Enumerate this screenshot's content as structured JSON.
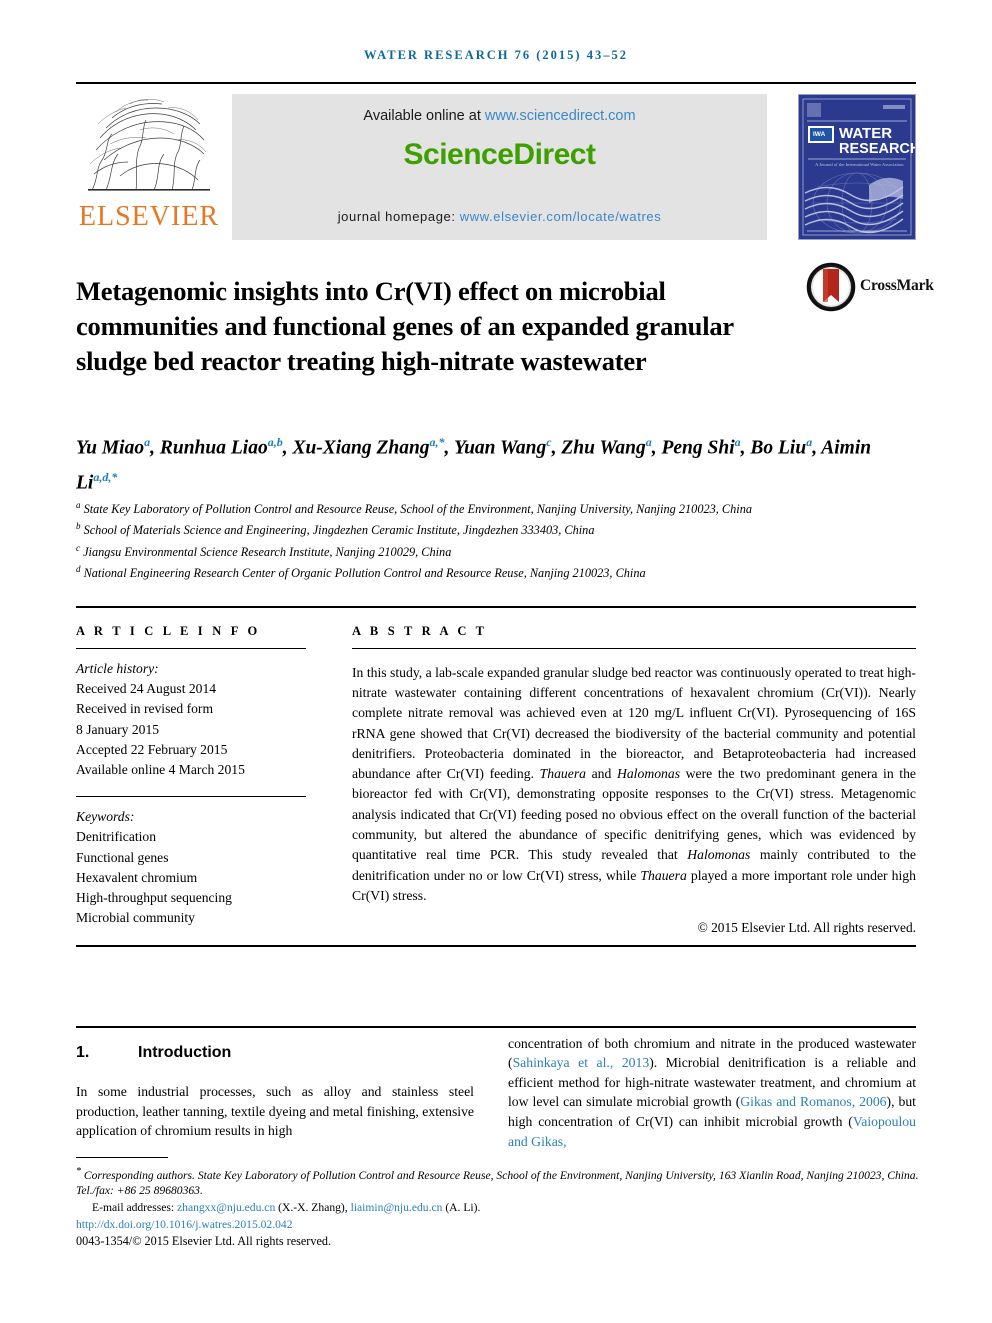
{
  "running_head": "WATER RESEARCH 76 (2015) 43–52",
  "masthead": {
    "available_text": "Available online at ",
    "available_url": "www.sciencedirect.com",
    "sciencedirect_logo": "ScienceDirect",
    "homepage_text": "journal homepage: ",
    "homepage_url": "www.elsevier.com/locate/watres",
    "elsevier_wordmark": "ELSEVIER",
    "cover": {
      "title_line1": "WATER",
      "title_line2": "RESEARCH",
      "imprint": "A Journal of the International Water Association",
      "iwa_logo": "IWA"
    }
  },
  "crossmark": {
    "label": "CrossMark"
  },
  "article": {
    "title": "Metagenomic insights into Cr(VI) effect on microbial communities and functional genes of an expanded granular sludge bed reactor treating high-nitrate wastewater",
    "authors": [
      {
        "name": "Yu Miao",
        "sup": "a",
        "sep": ", "
      },
      {
        "name": "Runhua Liao",
        "sup": "a,b",
        "sep": ", "
      },
      {
        "name": "Xu-Xiang Zhang",
        "sup": "a,*",
        "sep": ", "
      },
      {
        "name": "Yuan Wang",
        "sup": "c",
        "sep": ", "
      },
      {
        "name": "Zhu Wang",
        "sup": "a",
        "sep": ", "
      },
      {
        "name": "Peng Shi",
        "sup": "a",
        "sep": ", "
      },
      {
        "name": "Bo Liu",
        "sup": "a",
        "sep": ", "
      },
      {
        "name": "Aimin Li",
        "sup": "a,d,*",
        "sep": ""
      }
    ],
    "affiliations": [
      {
        "label": "a",
        "text": "State Key Laboratory of Pollution Control and Resource Reuse, School of the Environment, Nanjing University, Nanjing 210023, China"
      },
      {
        "label": "b",
        "text": "School of Materials Science and Engineering, Jingdezhen Ceramic Institute, Jingdezhen 333403, China"
      },
      {
        "label": "c",
        "text": "Jiangsu Environmental Science Research Institute, Nanjing 210029, China"
      },
      {
        "label": "d",
        "text": "National Engineering Research Center of Organic Pollution Control and Resource Reuse, Nanjing 210023, China"
      }
    ]
  },
  "article_info": {
    "heading": "A R T I C L E   I N F O",
    "history_label": "Article history:",
    "history": [
      "Received 24 August 2014",
      "Received in revised form",
      "8 January 2015",
      "Accepted 22 February 2015",
      "Available online 4 March 2015"
    ],
    "keywords_label": "Keywords:",
    "keywords": [
      "Denitrification",
      "Functional genes",
      "Hexavalent chromium",
      "High-throughput sequencing",
      "Microbial community"
    ]
  },
  "abstract": {
    "heading": "A B S T R A C T",
    "paragraph_parts": [
      {
        "t": "In this study, a lab-scale expanded granular sludge bed reactor was continuously operated to treat high-nitrate wastewater containing different concentrations of hexavalent chromium (Cr(VI)). Nearly complete nitrate removal was achieved even at 120 mg/L influent Cr(VI). Pyrosequencing of 16S rRNA gene showed that Cr(VI) decreased the biodiversity of the bacterial community and potential denitrifiers. Proteobacteria dominated in the bioreactor, and Betaproteobacteria had increased abundance after Cr(VI) feeding. "
      },
      {
        "t": "Thauera",
        "i": true
      },
      {
        "t": " and "
      },
      {
        "t": "Halomonas",
        "i": true
      },
      {
        "t": " were the two predominant genera in the bioreactor fed with Cr(VI), demonstrating opposite responses to the Cr(VI) stress. Metagenomic analysis indicated that Cr(VI) feeding posed no obvious effect on the overall function of the bacterial community, but altered the abundance of specific denitrifying genes, which was evidenced by quantitative real time PCR. This study revealed that "
      },
      {
        "t": "Halomonas",
        "i": true
      },
      {
        "t": " mainly contributed to the denitrification under no or low Cr(VI) stress, while "
      },
      {
        "t": "Thauera",
        "i": true
      },
      {
        "t": " played a more important role under high Cr(VI) stress."
      }
    ],
    "copyright": "© 2015 Elsevier Ltd. All rights reserved."
  },
  "introduction": {
    "number": "1.",
    "heading": "Introduction",
    "left_paragraph": "In some industrial processes, such as alloy and stainless steel production, leather tanning, textile dyeing and metal finishing, extensive application of chromium results in high",
    "right_parts": [
      {
        "t": "concentration of both chromium and nitrate in the produced wastewater ("
      },
      {
        "t": "Sahinkaya et al., 2013",
        "cite": true
      },
      {
        "t": "). Microbial denitrification is a reliable and efficient method for high-nitrate wastewater treatment, and chromium at low level can simulate microbial growth ("
      },
      {
        "t": "Gikas and Romanos, 2006",
        "cite": true
      },
      {
        "t": "), but high concentration of Cr(VI) can inhibit microbial growth ("
      },
      {
        "t": "Vaiopoulou and Gikas,",
        "cite": true
      }
    ]
  },
  "footnotes": {
    "corresponding": "Corresponding authors. State Key Laboratory of Pollution Control and Resource Reuse, School of the Environment, Nanjing University, 163 Xianlin Road, Nanjing 210023, China. Tel./fax: +86 25 89680363.",
    "email_label": "E-mail addresses: ",
    "email1": "zhangxx@nju.edu.cn",
    "email1_owner": " (X.-X. Zhang), ",
    "email2": "liaimin@nju.edu.cn",
    "email2_owner": " (A. Li).",
    "doi": "http://dx.doi.org/10.1016/j.watres.2015.02.042",
    "issn": "0043-1354/© 2015 Elsevier Ltd. All rights reserved."
  },
  "colors": {
    "running_head": "#0b6a9a",
    "link": "#2c7fb8",
    "sciencedirect_green": "#3da000",
    "elsevier_orange": "#e87722",
    "cover_blue": "#2b3a8f",
    "crossmark_red": "#b3261a"
  }
}
